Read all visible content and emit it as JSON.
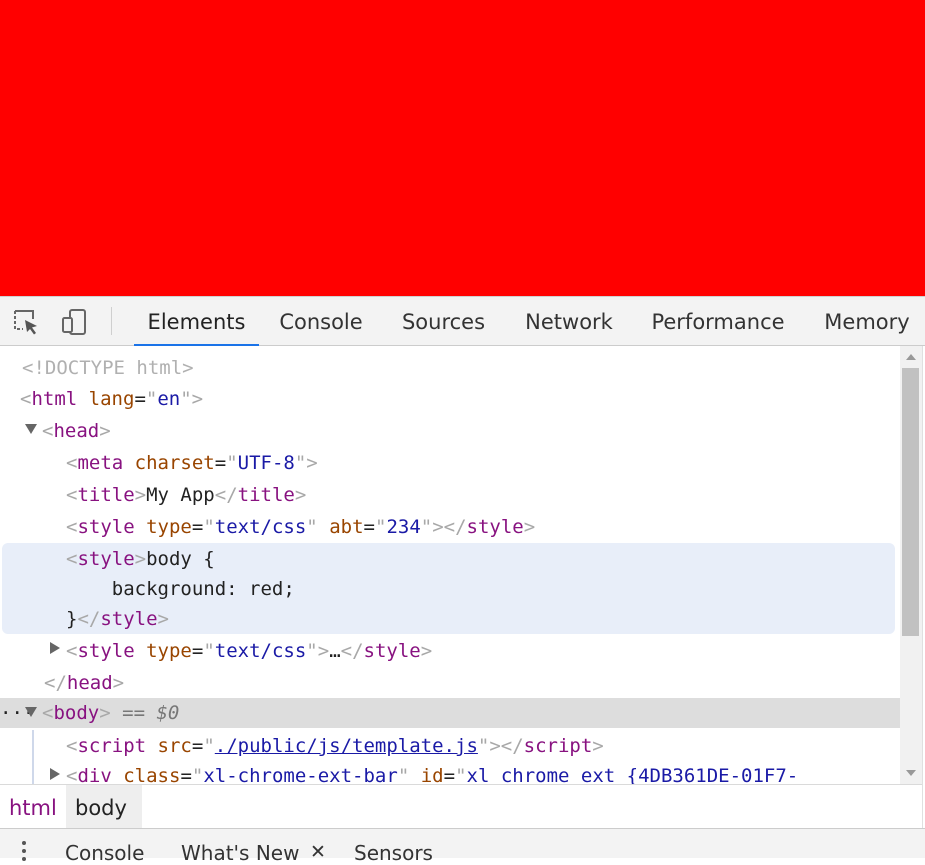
{
  "page": {
    "background_color": "#ff0000"
  },
  "devtools": {
    "tabs": [
      {
        "label": "Elements",
        "active": true
      },
      {
        "label": "Console"
      },
      {
        "label": "Sources"
      },
      {
        "label": "Network"
      },
      {
        "label": "Performance"
      },
      {
        "label": "Memory"
      }
    ],
    "accent_color": "#1a73e8",
    "icons": {
      "inspect": "inspect-element-icon",
      "device": "device-toolbar-icon"
    }
  },
  "dom": {
    "doctype": "<!DOCTYPE html>",
    "html": {
      "tag": "html",
      "attr_name": "lang",
      "attr_value": "en"
    },
    "head": {
      "tag": "head"
    },
    "meta": {
      "tag": "meta",
      "attr_name": "charset",
      "attr_value": "UTF-8"
    },
    "title": {
      "tag": "title",
      "text": "My App"
    },
    "style1": {
      "tag": "style",
      "attr1_name": "type",
      "attr1_value": "text/css",
      "attr2_name": "abt",
      "attr2_value": "234"
    },
    "style2": {
      "tag": "style",
      "line1": "body {",
      "line2": "    background: red;",
      "line3": "}"
    },
    "style3": {
      "tag": "style",
      "attr_name": "type",
      "attr_value": "text/css",
      "ellipsis": "…"
    },
    "body": {
      "tag": "body",
      "selected_marker": "== $0",
      "dots": "···"
    },
    "script": {
      "tag": "script",
      "attr_name": "src",
      "attr_value": "./public/js/template.js"
    },
    "div": {
      "tag": "div",
      "attr1_name": "class",
      "attr1_value": "xl-chrome-ext-bar",
      "attr2_name": "id",
      "attr2_value": "xl_chrome_ext_{4DB361DE-01F7-"
    }
  },
  "breadcrumbs": [
    "html",
    "body"
  ],
  "drawer": {
    "tabs": [
      {
        "label": "Console"
      },
      {
        "label": "What's New",
        "closable": true
      },
      {
        "label": "Sensors"
      }
    ],
    "close_glyph": "✕"
  }
}
